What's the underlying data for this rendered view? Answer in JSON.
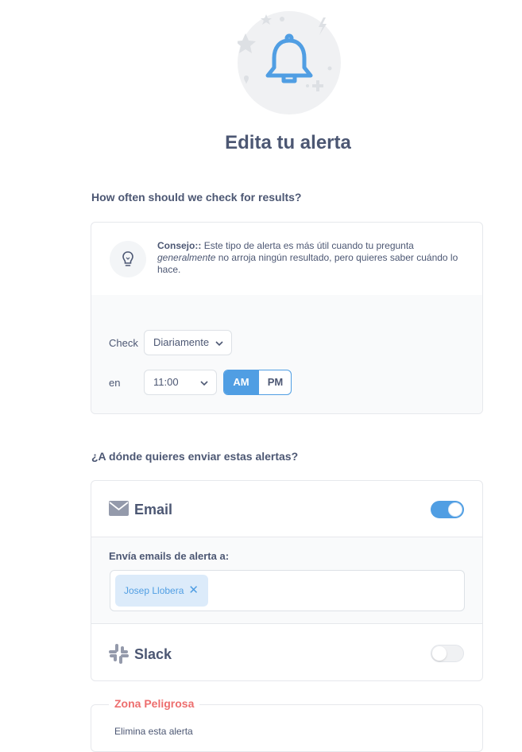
{
  "header": {
    "title": "Edita tu alerta"
  },
  "schedule": {
    "section_label": "How often should we check for results?",
    "tip": {
      "prefix": "Consejo::",
      "text_before": "Este tipo de alerta es más útil cuando tu pregunta",
      "emphasis": "generalmente",
      "text_after": "no arroja ningún resultado, pero quieres saber cuándo lo hace."
    },
    "check_label": "Check",
    "frequency_value": "Diariamente",
    "at_label": "en",
    "time_value": "11:00",
    "am_label": "AM",
    "pm_label": "PM",
    "selected_period": "AM"
  },
  "channels": {
    "section_label": "¿A dónde quieres enviar estas alertas?",
    "email": {
      "title": "Email",
      "enabled": true,
      "recipients_label": "Envía emails de alerta a:",
      "recipients": [
        "Josep Llobera"
      ],
      "remove_glyph": "✕"
    },
    "slack": {
      "title": "Slack",
      "enabled": false
    }
  },
  "danger_zone": {
    "title": "Zona Peligrosa",
    "text": "Elimina esta alerta"
  },
  "colors": {
    "brand": "#509ee3",
    "text": "#4c5773",
    "danger": "#ed6e6e"
  },
  "icons": {
    "hero": "bell-icon",
    "tip": "lightbulb-icon",
    "email": "envelope-icon",
    "slack": "slack-icon"
  }
}
